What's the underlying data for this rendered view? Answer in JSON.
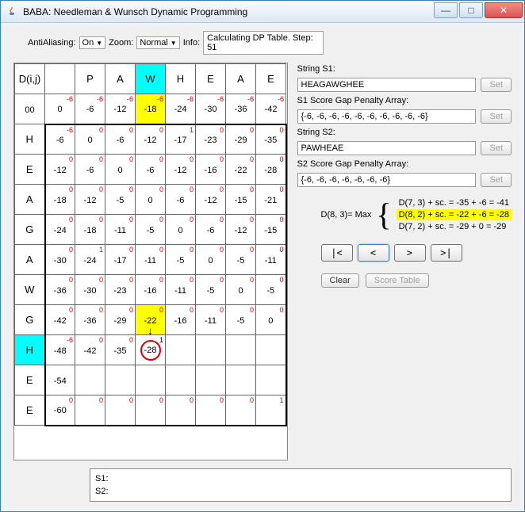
{
  "window": {
    "title": "BABA: Needleman & Wunsch Dynamic Programming"
  },
  "toolbar": {
    "aa_label": "AntiAliasing:",
    "aa_value": "On",
    "zoom_label": "Zoom:",
    "zoom_value": "Normal",
    "info_label": "Info:",
    "info_value": "Calculating DP Table. Step: 51"
  },
  "grid": {
    "corner": "D(i,j)",
    "cols": [
      "",
      "P",
      "A",
      "W",
      "H",
      "E",
      "A",
      "E"
    ],
    "rows": [
      "",
      "H",
      "E",
      "A",
      "G",
      "A",
      "W",
      "G",
      "H",
      "E",
      "E"
    ],
    "cells": [
      [
        {
          "sup": ""
        },
        {
          "sup": "-6",
          "v": "0"
        },
        {
          "sup": "-6",
          "v": "-6"
        },
        {
          "sup": "-6",
          "v": "-12"
        },
        {
          "sup": "-6",
          "v": "-18",
          "hl": "ye"
        },
        {
          "sup": "-6",
          "v": "-24"
        },
        {
          "sup": "-6",
          "v": "-30"
        },
        {
          "sup": "-6",
          "v": "-36"
        },
        {
          "sup": "-6",
          "v": "-42"
        }
      ],
      [
        {
          "sup": "-6",
          "v": "",
          "hd": "H"
        },
        {
          "sup": "-6",
          "v": "-6"
        },
        {
          "sup": "0",
          "v": "0"
        },
        {
          "sup": "0",
          "v": "-6"
        },
        {
          "sup": "0",
          "v": "-12"
        },
        {
          "sup": "1",
          "v": "-17"
        },
        {
          "sup": "0",
          "v": "-23"
        },
        {
          "sup": "0",
          "v": "-29"
        },
        {
          "sup": "0",
          "v": "-35"
        }
      ],
      [
        {
          "sup": "-6",
          "v": "",
          "hd": "E"
        },
        {
          "sup": "0",
          "v": "-12"
        },
        {
          "sup": "0",
          "v": "-6"
        },
        {
          "sup": "0",
          "v": "0"
        },
        {
          "sup": "0",
          "v": "-6"
        },
        {
          "sup": "0",
          "v": "-12"
        },
        {
          "sup": "0",
          "v": "-16"
        },
        {
          "sup": "0",
          "v": "-22"
        },
        {
          "sup": "0",
          "v": "-28"
        }
      ],
      [
        {
          "sup": "-6",
          "v": "",
          "hd": "A"
        },
        {
          "sup": "0",
          "v": "-18"
        },
        {
          "sup": "0",
          "v": "-12"
        },
        {
          "sup": "0",
          "v": "-5"
        },
        {
          "sup": "0",
          "v": "0"
        },
        {
          "sup": "0",
          "v": "-6"
        },
        {
          "sup": "0",
          "v": "-12"
        },
        {
          "sup": "0",
          "v": "-15"
        },
        {
          "sup": "0",
          "v": "-21"
        }
      ],
      [
        {
          "sup": "-6",
          "v": "",
          "hd": "G"
        },
        {
          "sup": "0",
          "v": "-24"
        },
        {
          "sup": "0",
          "v": "-18"
        },
        {
          "sup": "0",
          "v": "-11"
        },
        {
          "sup": "0",
          "v": "-5"
        },
        {
          "sup": "0",
          "v": "0"
        },
        {
          "sup": "0",
          "v": "-6"
        },
        {
          "sup": "0",
          "v": "-12"
        },
        {
          "sup": "0",
          "v": "-15"
        }
      ],
      [
        {
          "sup": "-6",
          "v": "",
          "hd": "A"
        },
        {
          "sup": "0",
          "v": "-30"
        },
        {
          "sup": "1",
          "v": "-24"
        },
        {
          "sup": "0",
          "v": "-17"
        },
        {
          "sup": "0",
          "v": "-11"
        },
        {
          "sup": "0",
          "v": "-5"
        },
        {
          "sup": "0",
          "v": "0"
        },
        {
          "sup": "0",
          "v": "-5"
        },
        {
          "sup": "0",
          "v": "-11"
        }
      ],
      [
        {
          "sup": "-6",
          "v": "",
          "hd": "W"
        },
        {
          "sup": "0",
          "v": "-36"
        },
        {
          "sup": "0",
          "v": "-30"
        },
        {
          "sup": "0",
          "v": "-23"
        },
        {
          "sup": "0",
          "v": "-16"
        },
        {
          "sup": "0",
          "v": "-11"
        },
        {
          "sup": "0",
          "v": "-5"
        },
        {
          "sup": "0",
          "v": "0"
        },
        {
          "sup": "0",
          "v": "-5"
        }
      ],
      [
        {
          "sup": "-6",
          "v": "",
          "hd": "G"
        },
        {
          "sup": "0",
          "v": "-42"
        },
        {
          "sup": "0",
          "v": "-36"
        },
        {
          "sup": "0",
          "v": "-29"
        },
        {
          "sup": "0",
          "v": "-22",
          "hl": "ye",
          "arrow": true
        },
        {
          "sup": "0",
          "v": "-16"
        },
        {
          "sup": "0",
          "v": "-11"
        },
        {
          "sup": "0",
          "v": "-5"
        },
        {
          "sup": "0",
          "v": "0"
        }
      ],
      [
        {
          "sup": "-6",
          "v": "",
          "hd": "H",
          "hl": "cy"
        },
        {
          "sup": "-6",
          "v": "-48"
        },
        {
          "sup": "0",
          "v": "-42"
        },
        {
          "sup": "0",
          "v": "-35"
        },
        {
          "sup": "1",
          "v": "-28",
          "circle": true,
          "supblk": true
        },
        {
          "sup": "",
          "v": ""
        },
        {
          "sup": "",
          "v": ""
        },
        {
          "sup": "",
          "v": ""
        },
        {
          "sup": "",
          "v": ""
        }
      ],
      [
        {
          "sup": "-6",
          "v": "",
          "hd": "E"
        },
        {
          "sup": "",
          "v": "-54"
        },
        {
          "sup": "",
          "v": ""
        },
        {
          "sup": "",
          "v": ""
        },
        {
          "sup": "",
          "v": ""
        },
        {
          "sup": "",
          "v": ""
        },
        {
          "sup": "",
          "v": ""
        },
        {
          "sup": "",
          "v": ""
        },
        {
          "sup": "",
          "v": ""
        }
      ],
      [
        {
          "sup": "-6",
          "v": "",
          "hd": "E"
        },
        {
          "sup": "0",
          "v": "-60"
        },
        {
          "sup": "0",
          "v": ""
        },
        {
          "sup": "0",
          "v": ""
        },
        {
          "sup": "0",
          "v": ""
        },
        {
          "sup": "0",
          "v": ""
        },
        {
          "sup": "0",
          "v": ""
        },
        {
          "sup": "0",
          "v": ""
        },
        {
          "sup": "1",
          "v": ""
        }
      ]
    ]
  },
  "side": {
    "s1_label": "String S1:",
    "s1_value": "HEAGAWGHEE",
    "s1arr_label": "S1 Score Gap Penalty Array:",
    "s1arr_value": "{-6, -6, -6, -6, -6, -6, -6, -6, -6, -6}",
    "s2_label": "String S2:",
    "s2_value": "PAWHEAE",
    "s2arr_label": "S2 Score Gap Penalty Array:",
    "s2arr_value": "{-6, -6, -6, -6, -6, -6, -6}",
    "set_label": "Set",
    "formula_left": "D(8, 3)= Max",
    "formula_lines": [
      "D(7, 3) + sc. = -35 + -6 = -41",
      "D(8, 2) + sc. = -22 + -6 = -28",
      "D(7, 2) + sc. = -29 + 0 = -29"
    ],
    "nav": {
      "first": "|<",
      "prev": "<",
      "next": ">",
      "last": ">|"
    },
    "clear_label": "Clear",
    "score_label": "Score Table"
  },
  "bottom": {
    "s1_label": "S1:",
    "s2_label": "S2:",
    "s1_value": "",
    "s2_value": ""
  }
}
